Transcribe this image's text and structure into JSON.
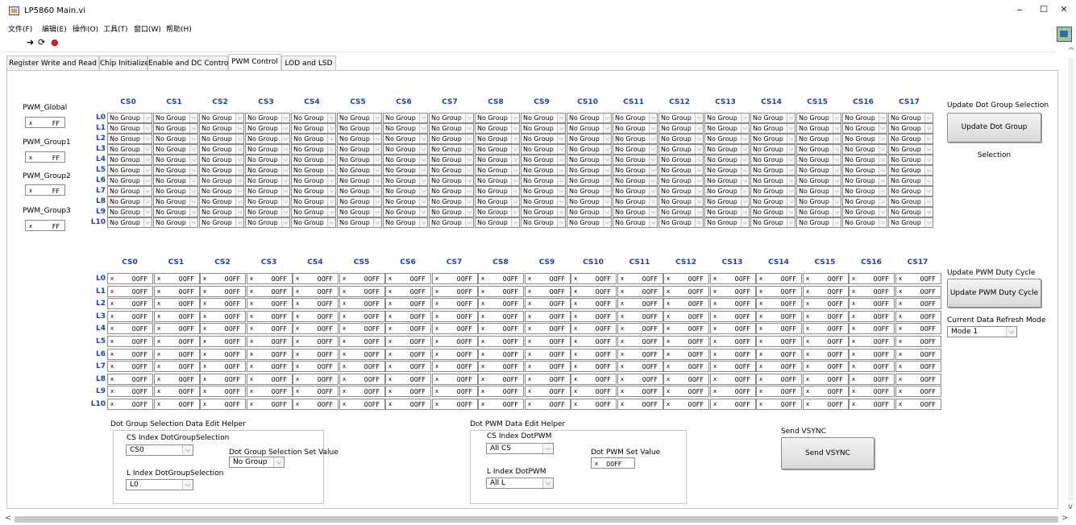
{
  "window": {
    "title": "LP5860 Main.vi",
    "minimize": "–",
    "maximize": "☐",
    "close": "✕"
  },
  "menu": [
    "文件(F)",
    "编辑(E)",
    "操作(O)",
    "工具(T)",
    "窗口(W)",
    "帮助(H)"
  ],
  "toolbar": {
    "run": "➜",
    "run_continuous": "⟳",
    "abort": "●"
  },
  "tabs": [
    "Register Write and Read",
    "Chip Initialize",
    "Enable and DC Control",
    "PWM Control",
    "LOD and LSD"
  ],
  "active_tab": "PWM Control",
  "pwm_globals": [
    {
      "label": "PWM_Global",
      "prefix": "x",
      "value": "FF"
    },
    {
      "label": "PWM_Group1",
      "prefix": "x",
      "value": "FF"
    },
    {
      "label": "PWM_Group2",
      "prefix": "x",
      "value": "FF"
    },
    {
      "label": "PWM_Group3",
      "prefix": "x",
      "value": "FF"
    }
  ],
  "columns": [
    "CS0",
    "CS1",
    "CS2",
    "CS3",
    "CS4",
    "CS5",
    "CS6",
    "CS7",
    "CS8",
    "CS9",
    "CS10",
    "CS11",
    "CS12",
    "CS13",
    "CS14",
    "CS15",
    "CS16",
    "CS17"
  ],
  "rows": [
    "L0",
    "L1",
    "L2",
    "L3",
    "L4",
    "L5",
    "L6",
    "L7",
    "L8",
    "L9",
    "L10"
  ],
  "group_cell_value": "No Group",
  "pwm_cell_prefix": "x",
  "pwm_cell_value": "00FF",
  "update_dot_group": {
    "label": "Update Dot Group Selection",
    "button": "Update Dot Group Selection"
  },
  "update_pwm": {
    "label": "Update PWM Duty Cycle",
    "button": "Update PWM Duty Cycle"
  },
  "refresh_mode": {
    "label": "Current Data Refresh Mode",
    "value": "Mode 1"
  },
  "dot_group_helper": {
    "title": "Dot Group Selection Data Edit Helper",
    "cs_label": "CS Index DotGroupSelection",
    "cs_value": "CS0",
    "l_label": "L Index DotGroupSelection",
    "l_value": "L0",
    "set_label": "Dot Group Selection Set Value",
    "set_value": "No Group"
  },
  "dot_pwm_helper": {
    "title": "Dot PWM Data Edit Helper",
    "cs_label": "CS Index DotPWM",
    "cs_value": "All CS",
    "l_label": "L Index DotPWM",
    "l_value": "All L",
    "set_label": "Dot PWM Set Value",
    "set_prefix": "x",
    "set_value": "00FF"
  },
  "vsync": {
    "label": "Send VSYNC",
    "button": "Send VSYNC"
  },
  "scroll": {
    "left": "<",
    "right": ">",
    "up": "^",
    "down": "v"
  }
}
